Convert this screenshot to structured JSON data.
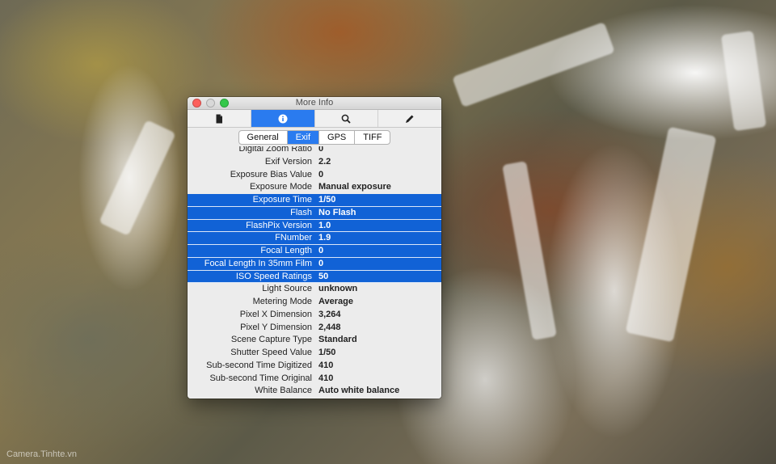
{
  "window": {
    "title": "More Info"
  },
  "toolbar": {
    "items": [
      {
        "icon": "document-icon"
      },
      {
        "icon": "info-icon"
      },
      {
        "icon": "magnifier-icon"
      },
      {
        "icon": "pencil-icon"
      }
    ]
  },
  "tabs": {
    "items": [
      {
        "label": "General"
      },
      {
        "label": "Exif"
      },
      {
        "label": "GPS"
      },
      {
        "label": "TIFF"
      }
    ],
    "selected": "Exif"
  },
  "exif": {
    "rows": [
      {
        "key": "Digital Zoom Ratio",
        "value": "0"
      },
      {
        "key": "Exif Version",
        "value": "2.2"
      },
      {
        "key": "Exposure Bias Value",
        "value": "0"
      },
      {
        "key": "Exposure Mode",
        "value": "Manual exposure"
      },
      {
        "key": "Exposure Time",
        "value": "1/50"
      },
      {
        "key": "Flash",
        "value": "No Flash"
      },
      {
        "key": "FlashPix Version",
        "value": "1.0"
      },
      {
        "key": "FNumber",
        "value": "1.9"
      },
      {
        "key": "Focal Length",
        "value": "0"
      },
      {
        "key": "Focal Length In 35mm Film",
        "value": "0"
      },
      {
        "key": "ISO Speed Ratings",
        "value": "50"
      },
      {
        "key": "Light Source",
        "value": "unknown"
      },
      {
        "key": "Metering Mode",
        "value": "Average"
      },
      {
        "key": "Pixel X Dimension",
        "value": "3,264"
      },
      {
        "key": "Pixel Y Dimension",
        "value": "2,448"
      },
      {
        "key": "Scene Capture Type",
        "value": "Standard"
      },
      {
        "key": "Shutter Speed Value",
        "value": "1/50"
      },
      {
        "key": "Sub-second Time Digitized",
        "value": "410"
      },
      {
        "key": "Sub-second Time Original",
        "value": "410"
      },
      {
        "key": "White Balance",
        "value": "Auto white balance"
      }
    ]
  },
  "colors": {
    "accent": "#2a7bef",
    "selection": "#1162d6"
  },
  "watermark": "Camera.Tinhte.vn"
}
